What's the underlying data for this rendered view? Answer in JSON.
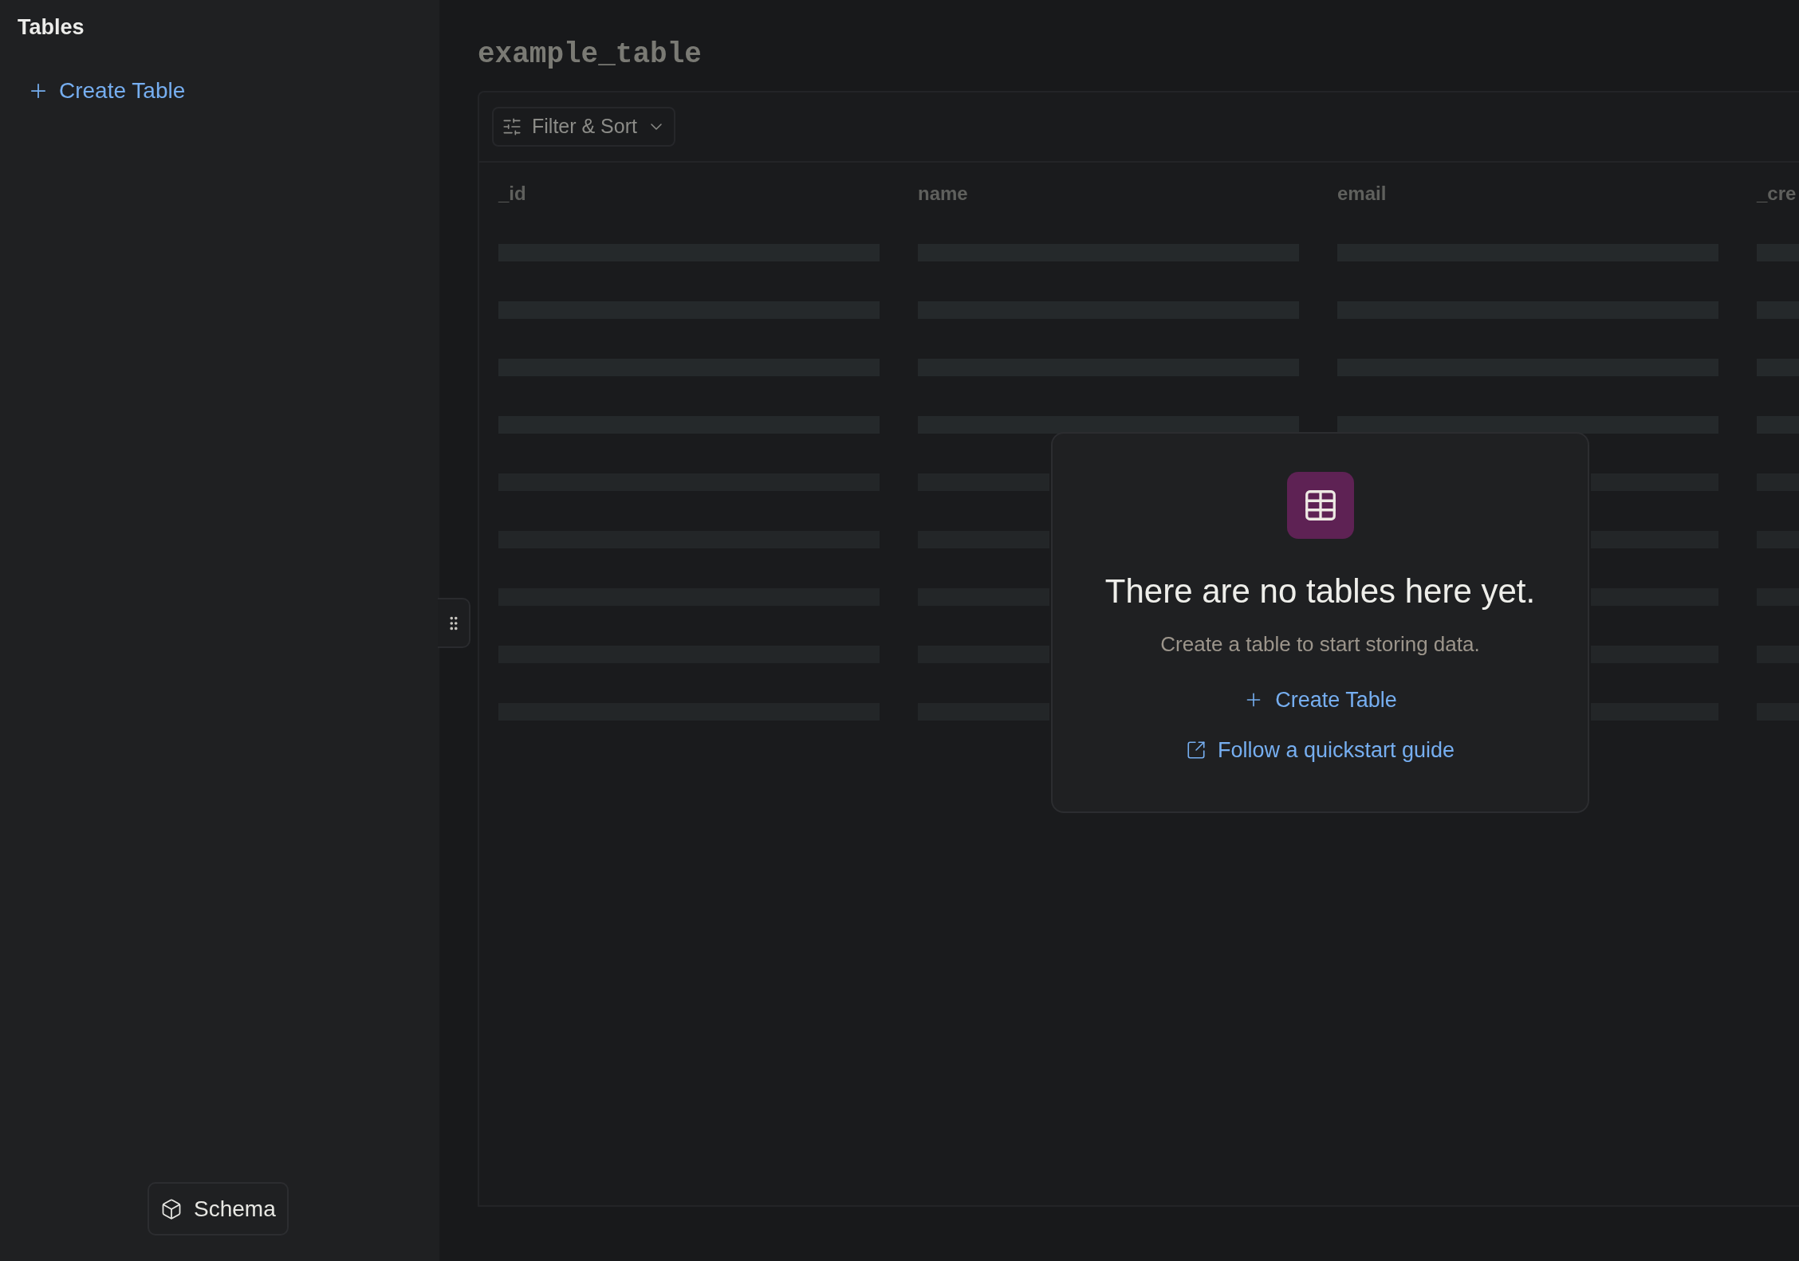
{
  "sidebar": {
    "title": "Tables",
    "create_button": "Create Table",
    "schema_button": "Schema"
  },
  "main": {
    "title": "example_table",
    "filter_button": "Filter & Sort",
    "table": {
      "columns": [
        "_id",
        "name",
        "email",
        "_cre"
      ]
    }
  },
  "empty_state": {
    "heading": "There are no tables here yet.",
    "message": "Create a table to start storing data.",
    "create_link": "Create Table",
    "guide_link": "Follow a quickstart guide"
  }
}
